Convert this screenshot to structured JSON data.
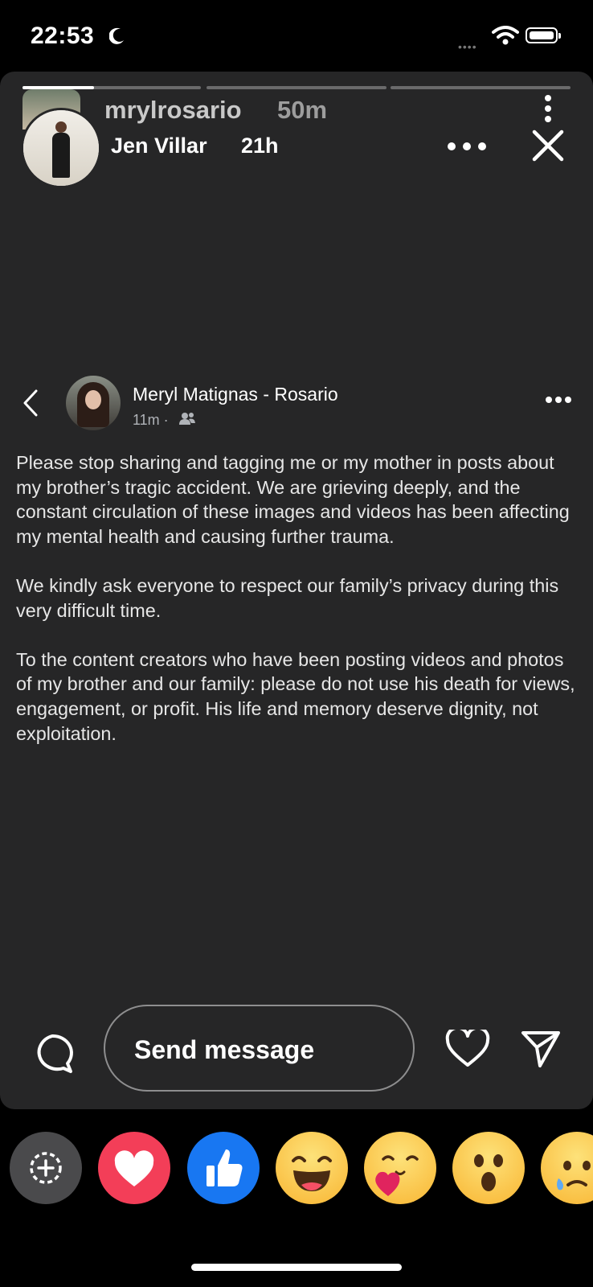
{
  "status_bar": {
    "time": "22:53",
    "icons": [
      "moon-icon",
      "cellular-dots",
      "wifi-icon",
      "battery-icon"
    ]
  },
  "story": {
    "progress_segments": [
      0.4,
      0,
      0
    ],
    "username": "mrylrosario",
    "time_ago": "50m",
    "shared_from": "Jen Villar",
    "shared_ago": "21h",
    "icons": {
      "more_vertical": "kebab-vertical-icon",
      "more_horizontal": "more-horizontal-icon",
      "close": "close-icon"
    }
  },
  "post": {
    "author": "Meryl Matignas - Rosario",
    "time": "11m ·",
    "audience_icon": "friends-icon",
    "paragraphs": [
      "Please stop sharing and tagging me or my mother in posts about my brother’s tragic accident. We are grieving deeply, and the constant circulation of these images and videos has been affecting my mental health and causing further trauma.",
      "We kindly ask everyone to respect our family’s privacy during this very difficult time.",
      "To the content creators who have been posting videos and photos of my brother and our family: please do not use his death for views, engagement, or profit. His life and memory deserve dignity, not exploitation."
    ]
  },
  "reply_bar": {
    "placeholder": "Send message",
    "icons": [
      "reply-bubble-icon",
      "heart-icon",
      "share-icon"
    ]
  },
  "reactions": [
    "add-reaction-icon",
    "heart-reaction",
    "like-reaction",
    "laugh-reaction",
    "care-reaction",
    "wow-reaction",
    "sad-reaction"
  ],
  "colors": {
    "story_bg": "#262627",
    "heart_red": "#f33e58",
    "like_blue": "#1877f2",
    "emoji_yellow": "#fbc93d"
  }
}
